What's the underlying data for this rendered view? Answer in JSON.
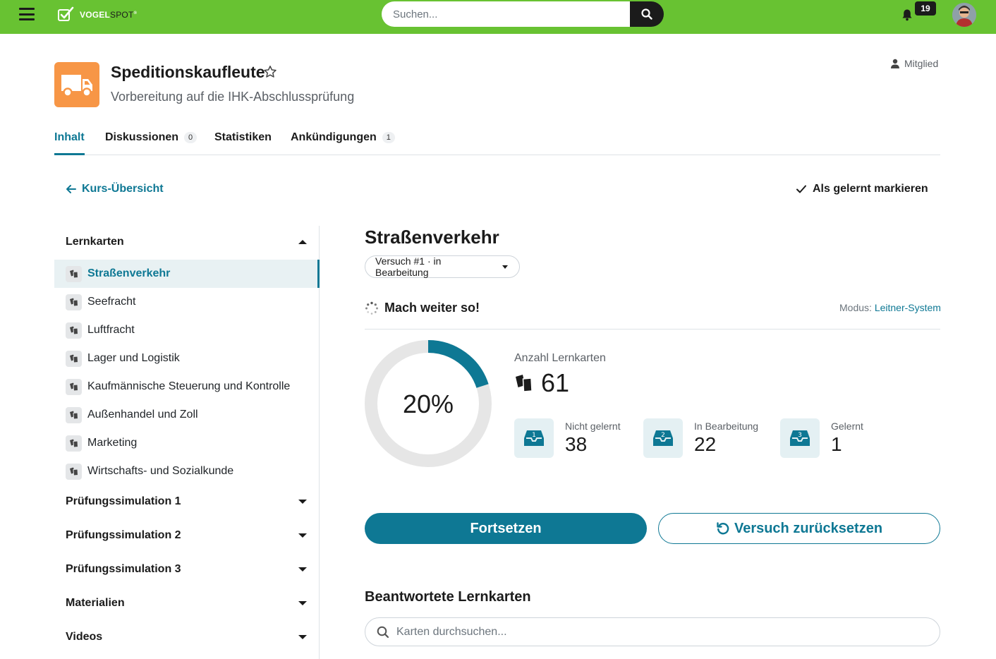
{
  "topbar": {
    "logo_main": "VOGEL",
    "logo_accent": "SPOT",
    "search_placeholder": "Suchen...",
    "notification_count": "19"
  },
  "course": {
    "title": "Speditionskaufleute",
    "subtitle": "Vorbereitung auf die IHK-Abschlussprüfung",
    "role": "Mitglied",
    "icon": "truck-icon",
    "icon_color": "#f79646"
  },
  "tabs": [
    {
      "label": "Inhalt",
      "badge": ""
    },
    {
      "label": "Diskussionen",
      "badge": "0"
    },
    {
      "label": "Statistiken",
      "badge": ""
    },
    {
      "label": "Ankündigungen",
      "badge": "1"
    }
  ],
  "actions": {
    "back_label": "Kurs-Übersicht",
    "mark_learned_label": "Als gelernt markieren"
  },
  "sidebar": {
    "section_lernkarten": "Lernkarten",
    "items": [
      "Straßenverkehr",
      "Seefracht",
      "Luftfracht",
      "Lager und Logistik",
      "Kaufmännische Steuerung und Kontrolle",
      "Außenhandel und Zoll",
      "Marketing",
      "Wirtschafts- und Sozialkunde"
    ],
    "sections": [
      "Prüfungssimulation 1",
      "Prüfungssimulation 2",
      "Prüfungssimulation 3",
      "Materialien",
      "Videos"
    ]
  },
  "main": {
    "title": "Straßenverkehr",
    "attempt": "Versuch #1 · in Bearbeitung",
    "status": "Mach weiter so!",
    "mode_label": "Modus:",
    "mode_value": "Leitner-System",
    "progress_percent": 20,
    "progress_label": "20%",
    "count_label": "Anzahl Lernkarten",
    "count_value": "61",
    "boxes": [
      {
        "number": "1",
        "label": "Nicht gelernt",
        "value": "38"
      },
      {
        "number": "2",
        "label": "In Bearbeitung",
        "value": "22"
      },
      {
        "number": "3",
        "label": "Gelernt",
        "value": "1"
      }
    ],
    "continue_label": "Fortsetzen",
    "reset_label": "Versuch zurücksetzen",
    "answered_title": "Beantwortete Lernkarten",
    "card_search_placeholder": "Karten durchsuchen..."
  },
  "colors": {
    "brand_green": "#68c232",
    "accent_teal": "#0e7894",
    "dark": "#1b1b1b"
  }
}
